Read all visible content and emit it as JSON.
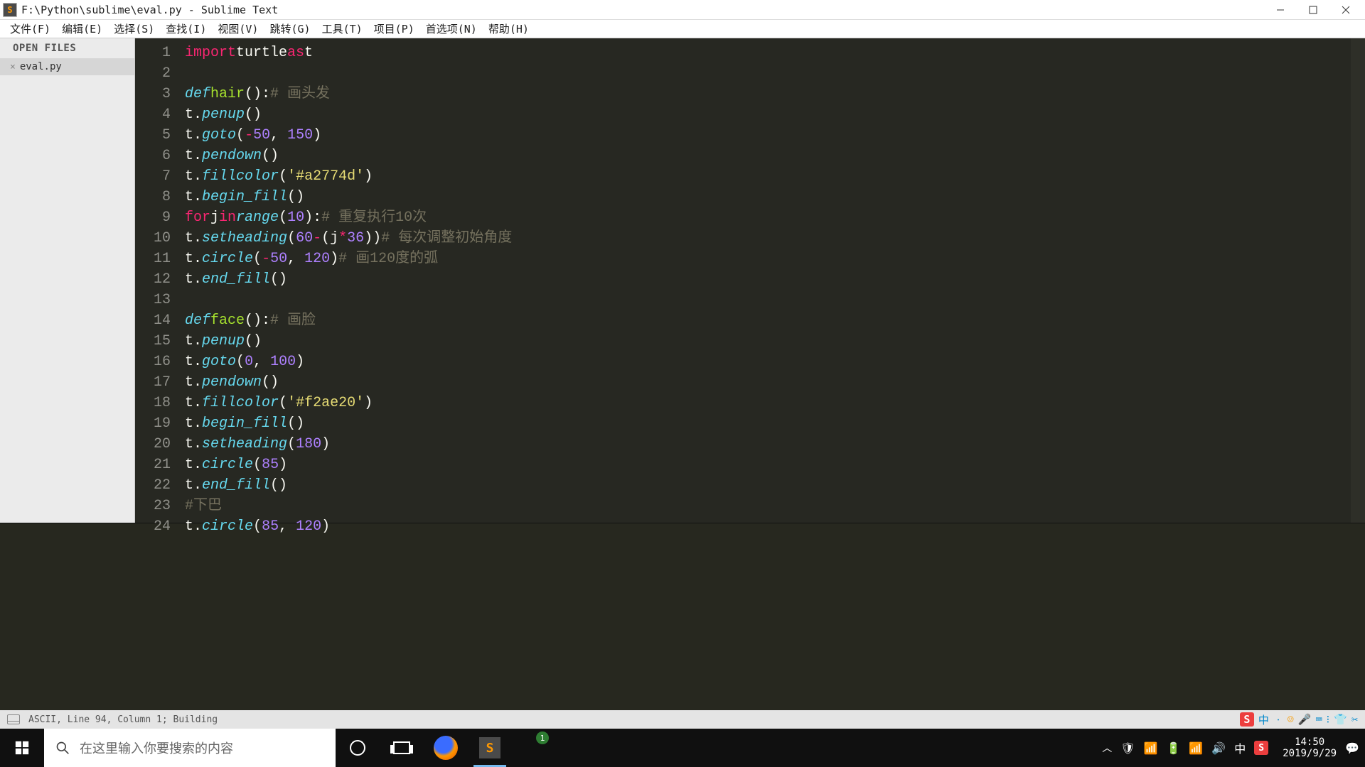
{
  "titlebar": {
    "title": "F:\\Python\\sublime\\eval.py - Sublime Text",
    "appicon_letter": "S"
  },
  "menus": [
    "文件(F)",
    "编辑(E)",
    "选择(S)",
    "查找(I)",
    "视图(V)",
    "跳转(G)",
    "工具(T)",
    "项目(P)",
    "首选项(N)",
    "帮助(H)"
  ],
  "sidebar": {
    "heading": "OPEN FILES",
    "file": "eval.py"
  },
  "code": {
    "lines": [
      {
        "n": "1",
        "html": "<span class='kw2'>import</span> <span class='var'>turtle</span> <span class='kw2'>as</span> <span class='var'>t</span>"
      },
      {
        "n": "2",
        "html": ""
      },
      {
        "n": "3",
        "html": "<span class='fn'>def</span> <span class='def'>hair</span><span class='pun'>():</span>     <span class='cm'># 画头发</span>"
      },
      {
        "n": "4",
        "html": "    <span class='var'>t</span><span class='pun'>.</span><span class='fn'>penup</span><span class='pun'>()</span>"
      },
      {
        "n": "5",
        "html": "    <span class='var'>t</span><span class='pun'>.</span><span class='fn'>goto</span><span class='pun'>(</span><span class='op'>-</span><span class='num'>50</span><span class='pun'>, </span><span class='num'>150</span><span class='pun'>)</span>"
      },
      {
        "n": "6",
        "html": "    <span class='var'>t</span><span class='pun'>.</span><span class='fn'>pendown</span><span class='pun'>()</span>"
      },
      {
        "n": "7",
        "html": "    <span class='var'>t</span><span class='pun'>.</span><span class='fn'>fillcolor</span><span class='pun'>(</span><span class='str'>'#a2774d'</span><span class='pun'>)</span>"
      },
      {
        "n": "8",
        "html": "    <span class='var'>t</span><span class='pun'>.</span><span class='fn'>begin_fill</span><span class='pun'>()</span>"
      },
      {
        "n": "9",
        "html": "    <span class='ctrl'>for</span> <span class='var'>j</span> <span class='ctrl'>in</span> <span class='fn'>range</span><span class='pun'>(</span><span class='num'>10</span><span class='pun'>):</span>                <span class='cm'># 重复执行10次</span>"
      },
      {
        "n": "10",
        "html": "        <span class='var'>t</span><span class='pun'>.</span><span class='fn'>setheading</span><span class='pun'>(</span><span class='num'>60</span> <span class='op'>-</span> <span class='pun'>(</span><span class='var'>j</span> <span class='op'>*</span> <span class='num'>36</span><span class='pun'>))</span>       <span class='cm'># 每次调整初始角度</span>"
      },
      {
        "n": "11",
        "html": "        <span class='var'>t</span><span class='pun'>.</span><span class='fn'>circle</span><span class='pun'>(</span><span class='op'>-</span><span class='num'>50</span><span class='pun'>, </span><span class='num'>120</span><span class='pun'>)</span>              <span class='cm'># 画120度的弧</span>"
      },
      {
        "n": "12",
        "html": "    <span class='var'>t</span><span class='pun'>.</span><span class='fn'>end_fill</span><span class='pun'>()</span>"
      },
      {
        "n": "13",
        "html": ""
      },
      {
        "n": "14",
        "html": "<span class='fn'>def</span> <span class='def'>face</span><span class='pun'>():</span>     <span class='cm'># 画脸</span>"
      },
      {
        "n": "15",
        "html": "    <span class='var'>t</span><span class='pun'>.</span><span class='fn'>penup</span><span class='pun'>()</span>"
      },
      {
        "n": "16",
        "html": "    <span class='var'>t</span><span class='pun'>.</span><span class='fn'>goto</span><span class='pun'>(</span><span class='num'>0</span><span class='pun'>, </span><span class='num'>100</span><span class='pun'>)</span>"
      },
      {
        "n": "17",
        "html": "    <span class='var'>t</span><span class='pun'>.</span><span class='fn'>pendown</span><span class='pun'>()</span>"
      },
      {
        "n": "18",
        "html": "    <span class='var'>t</span><span class='pun'>.</span><span class='fn'>fillcolor</span><span class='pun'>(</span><span class='str'>'#f2ae20'</span><span class='pun'>)</span>"
      },
      {
        "n": "19",
        "html": "    <span class='var'>t</span><span class='pun'>.</span><span class='fn'>begin_fill</span><span class='pun'>()</span>"
      },
      {
        "n": "20",
        "html": "    <span class='var'>t</span><span class='pun'>.</span><span class='fn'>setheading</span><span class='pun'>(</span><span class='num'>180</span><span class='pun'>)</span>"
      },
      {
        "n": "21",
        "html": "    <span class='var'>t</span><span class='pun'>.</span><span class='fn'>circle</span><span class='pun'>(</span><span class='num'>85</span><span class='pun'>)</span>"
      },
      {
        "n": "22",
        "html": "    <span class='var'>t</span><span class='pun'>.</span><span class='fn'>end_fill</span><span class='pun'>()</span>"
      },
      {
        "n": "23",
        "html": "    <span class='cm'>#下巴</span>"
      },
      {
        "n": "24",
        "html": "    <span class='var'>t</span><span class='pun'>.</span><span class='fn'>circle</span><span class='pun'>(</span><span class='num'>85</span><span class='pun'>, </span><span class='num'>120</span><span class='pun'>)</span>"
      }
    ]
  },
  "status": {
    "text": "ASCII, Line 94, Column 1; Building",
    "ime": [
      "中",
      "ㆍ",
      "☺",
      "🎤",
      "⌨",
      "⁝",
      "👕",
      "✂"
    ]
  },
  "taskbar": {
    "search_placeholder": "在这里输入你要搜索的内容",
    "badge": "1",
    "tray_lang": "中",
    "time": "14:50",
    "date": "2019/9/29"
  }
}
